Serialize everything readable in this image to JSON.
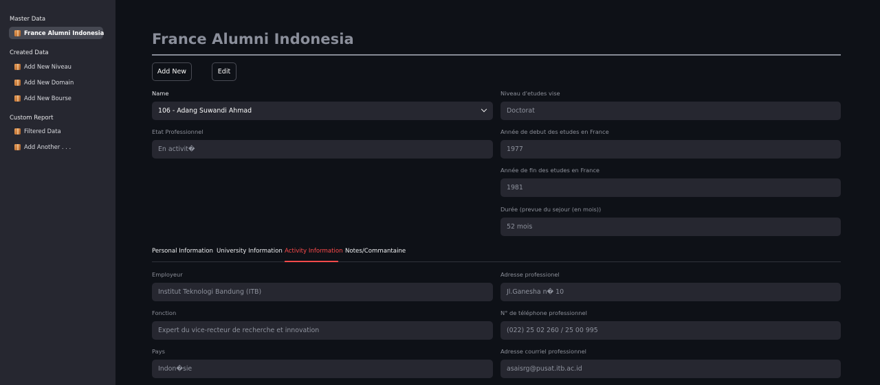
{
  "sidebar": {
    "sections": [
      {
        "title": "Master Data",
        "items": [
          {
            "label": "France Alumni Indonesia",
            "active": true,
            "icon": "package-icon"
          }
        ]
      },
      {
        "title": "Created Data",
        "items": [
          {
            "label": "Add New Niveau",
            "icon": "package-icon"
          },
          {
            "label": "Add New Domain",
            "icon": "package-icon"
          },
          {
            "label": "Add New Bourse",
            "icon": "package-icon"
          }
        ]
      },
      {
        "title": "Custom Report",
        "items": [
          {
            "label": "Filtered Data",
            "icon": "package-icon"
          },
          {
            "label": "Add Another . . .",
            "icon": "package-icon"
          }
        ]
      }
    ]
  },
  "main": {
    "title": "France Alumni Indonesia",
    "buttons": {
      "add_new": "Add New",
      "edit": "Edit"
    },
    "name_field": {
      "label": "Name",
      "value": "106 - Adang Suwandi Ahmad"
    },
    "etat": {
      "label": "Etat Professionnel",
      "value": "En activit�"
    },
    "niveau": {
      "label": "Niveau d'etudes vise",
      "value": "Doctorat"
    },
    "annee_debut": {
      "label": "Année de debut des etudes en France",
      "value": "1977"
    },
    "annee_fin": {
      "label": "Année de fin des etudes en France",
      "value": "1981"
    },
    "duree": {
      "label": "Durée (prevue du sejour (en mois))",
      "value": "52 mois"
    },
    "tabs": [
      {
        "label": "Personal Information",
        "active": false
      },
      {
        "label": "University Information",
        "active": false
      },
      {
        "label": "Activity Information",
        "active": true
      },
      {
        "label": "Notes/Commantaine",
        "active": false
      }
    ],
    "activity": {
      "employeur": {
        "label": "Employeur",
        "value": "Institut Teknologi Bandung (ITB)"
      },
      "adresse_pro": {
        "label": "Adresse professionel",
        "value": "Jl.Ganesha n� 10"
      },
      "fonction": {
        "label": "Fonction",
        "value": "Expert du vice-recteur de recherche et innovation"
      },
      "telephone": {
        "label": "N° de téléphone professionnel",
        "value": "(022) 25 02 260 / 25 00 995"
      },
      "pays": {
        "label": "Pays",
        "value": "Indon�sie"
      },
      "courriel": {
        "label": "Adresse courriel professionnel",
        "value": "asaisrg@pusat.itb.ac.id"
      }
    }
  },
  "colors": {
    "background": "#0e1117",
    "sidebar": "#262730",
    "field": "#262730",
    "accent": "#ff4b4b"
  }
}
